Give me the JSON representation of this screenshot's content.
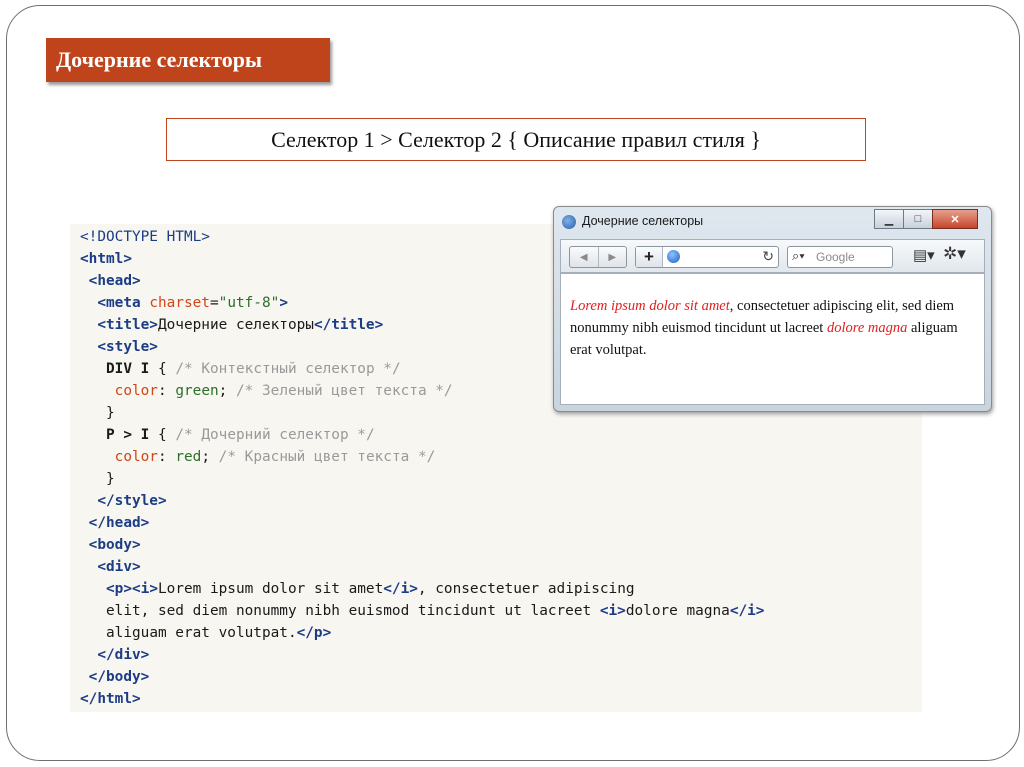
{
  "slide": {
    "title": "Дочерние селекторы",
    "syntax": "Селектор 1 > Селектор 2 { Описание правил стиля }"
  },
  "code": {
    "doctype": "<!DOCTYPE HTML>",
    "html_open": "<html>",
    "head_open": "<head>",
    "meta_tag_start": "<meta",
    "meta_attr": "charset",
    "meta_eq": "=",
    "meta_value": "\"utf-8\"",
    "meta_tag_end": ">",
    "title_open": "<title>",
    "title_text": "Дочерние селекторы",
    "title_close": "</title>",
    "style_open": "<style>",
    "rule1_selector": "DIV I",
    "rule1_brace": "{",
    "rule1_comment": "/* Контекстный селектор */",
    "rule1_prop": "color",
    "rule1_colon": ":",
    "rule1_value": "green",
    "rule1_semi": ";",
    "rule1_prop_comment": "/* Зеленый цвет текста */",
    "rule1_close": "}",
    "rule2_selector": "P > I",
    "rule2_brace": "{",
    "rule2_comment": "/* Дочерний селектор */",
    "rule2_prop": "color",
    "rule2_colon": ":",
    "rule2_value": "red",
    "rule2_semi": ";",
    "rule2_prop_comment": "/* Красный цвет текста */",
    "rule2_close": "}",
    "style_close": "</style>",
    "head_close": "</head>",
    "body_open": "<body>",
    "div_open": "<div>",
    "p_open": "<p>",
    "i_open": "<i>",
    "i_text1": "Lorem ipsum dolor sit amet",
    "i_close": "</i>",
    "text_line1_rest": ", consectetuer adipiscing",
    "text_line2": "elit, sed diem nonummy nibh euismod tincidunt ut lacreet ",
    "i_open2": "<i>",
    "i_text2": "dolore magna",
    "i_close2": "</i>",
    "text_line3": "aliguam erat volutpat.",
    "p_close": "</p>",
    "div_close": "</div>",
    "body_close": "</body>",
    "html_close": "</html>"
  },
  "browser": {
    "window_title": "Дочерние селекторы",
    "back_glyph": "◀",
    "forward_glyph": "▶",
    "plus_glyph": "+",
    "reload_glyph": "↻",
    "search_glyph": "⌕▾",
    "search_placeholder": "Google",
    "page_glyph": "▤▾",
    "gear_glyph": "✲▾",
    "minimize_glyph": "▁",
    "maximize_glyph": "□",
    "close_glyph": "✕",
    "text_italic1": "Lorem ipsum dolor sit amet",
    "text_middle": ", consectetuer adipiscing elit, sed diem nonummy nibh euismod tincidunt ut lacreet ",
    "text_italic2": "dolore magna",
    "text_end": " aliguam erat volutpat."
  },
  "colors": {
    "accent": "#c0441b",
    "italic_red": "#e02020",
    "tag_blue": "#1c3d86",
    "comment_gray": "#9a9a9a"
  }
}
